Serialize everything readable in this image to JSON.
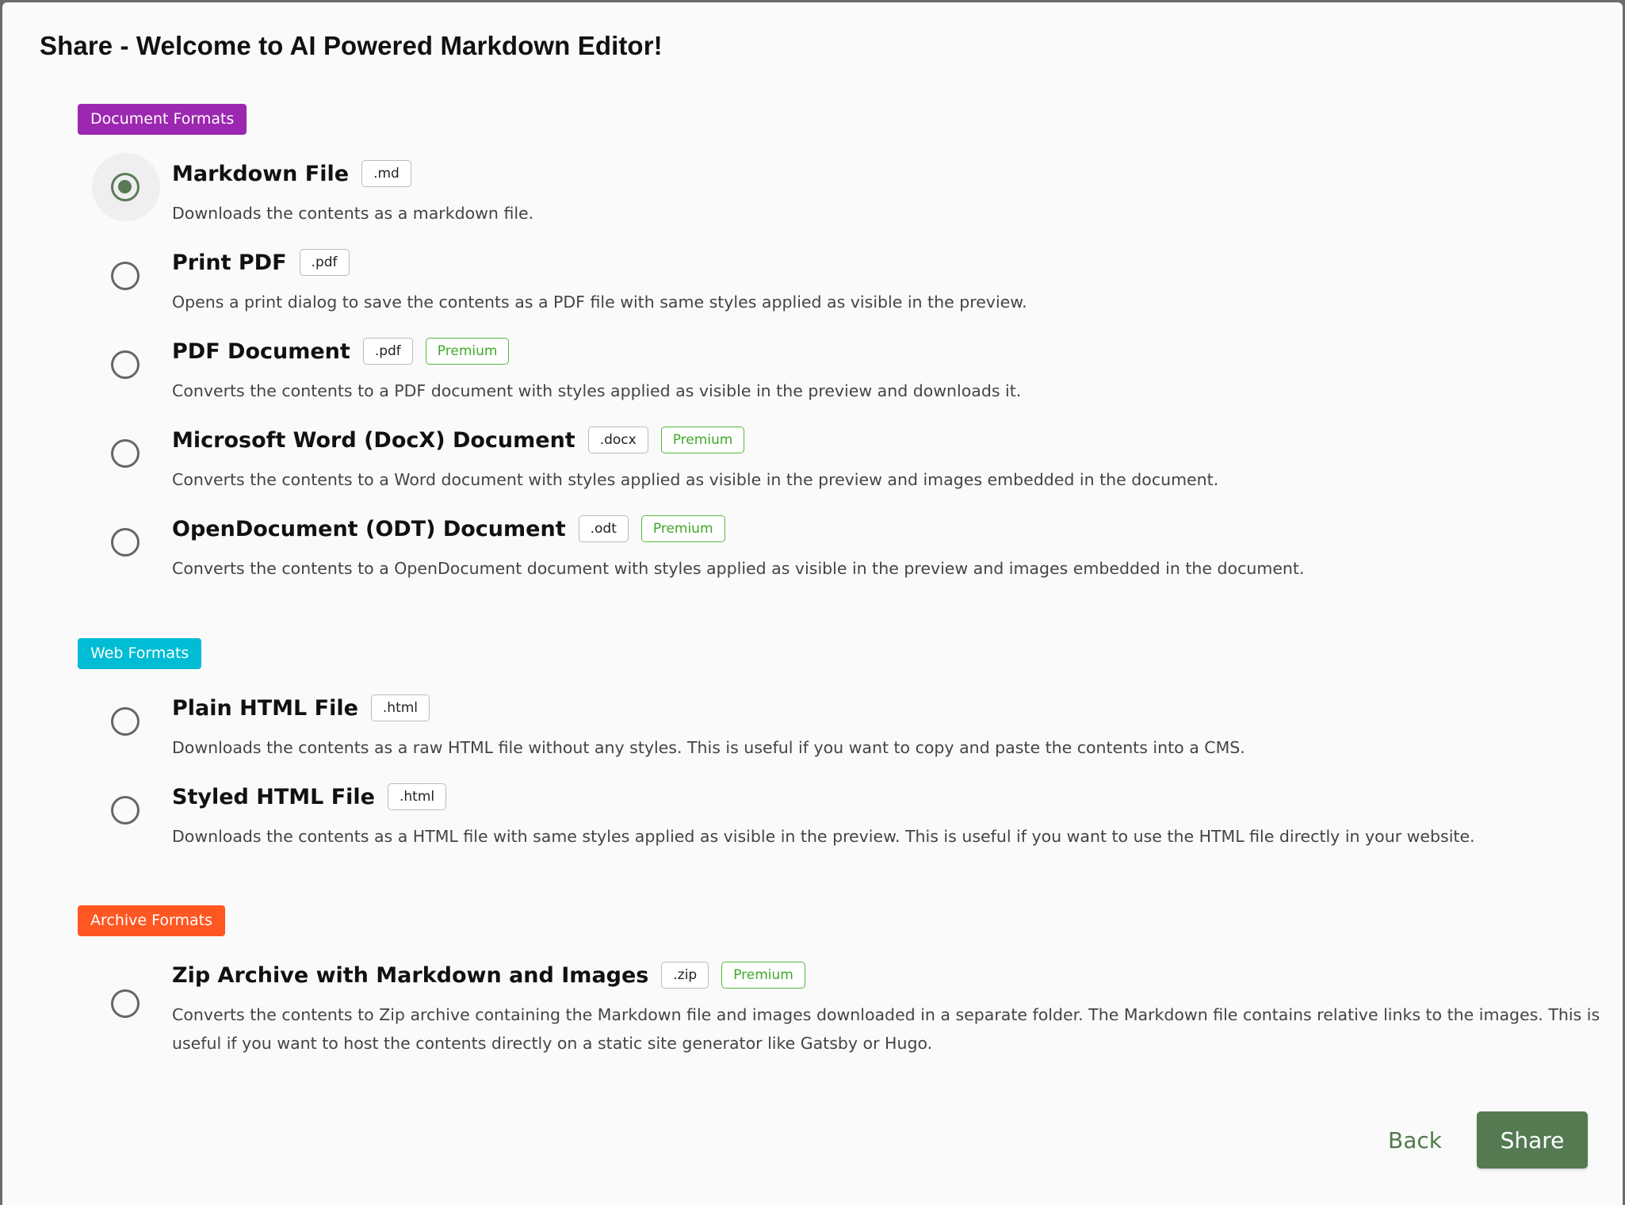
{
  "dialog": {
    "title": "Share - Welcome to AI Powered Markdown Editor!"
  },
  "sections": [
    {
      "label": "Document Formats",
      "color": "#9c27b0",
      "options": [
        {
          "title": "Markdown File",
          "ext": ".md",
          "premium": "",
          "desc": "Downloads the contents as a markdown file.",
          "selected": true
        },
        {
          "title": "Print PDF",
          "ext": ".pdf",
          "premium": "",
          "desc": "Opens a print dialog to save the contents as a PDF file with same styles applied as visible in the preview.",
          "selected": false
        },
        {
          "title": "PDF Document",
          "ext": ".pdf",
          "premium": "Premium",
          "desc": "Converts the contents to a PDF document with styles applied as visible in the preview and downloads it.",
          "selected": false
        },
        {
          "title": "Microsoft Word (DocX) Document",
          "ext": ".docx",
          "premium": "Premium",
          "desc": "Converts the contents to a Word document with styles applied as visible in the preview and images embedded in the document.",
          "selected": false
        },
        {
          "title": "OpenDocument (ODT) Document",
          "ext": ".odt",
          "premium": "Premium",
          "desc": "Converts the contents to a OpenDocument document with styles applied as visible in the preview and images embedded in the document.",
          "selected": false
        }
      ]
    },
    {
      "label": "Web Formats",
      "color": "#00bcd4",
      "options": [
        {
          "title": "Plain HTML File",
          "ext": ".html",
          "premium": "",
          "desc": "Downloads the contents as a raw HTML file without any styles. This is useful if you want to copy and paste the contents into a CMS.",
          "selected": false
        },
        {
          "title": "Styled HTML File",
          "ext": ".html",
          "premium": "",
          "desc": "Downloads the contents as a HTML file with same styles applied as visible in the preview. This is useful if you want to use the HTML file directly in your website.",
          "selected": false
        }
      ]
    },
    {
      "label": "Archive Formats",
      "color": "#ff5722",
      "options": [
        {
          "title": "Zip Archive with Markdown and Images",
          "ext": ".zip",
          "premium": "Premium",
          "desc": "Converts the contents to Zip archive containing the Markdown file and images downloaded in a separate folder. The Markdown file contains relative links to the images. This is useful if you want to host the contents directly on a static site generator like Gatsby or Hugo.",
          "selected": false
        }
      ]
    }
  ],
  "footer": {
    "back_label": "Back",
    "share_label": "Share",
    "accent_color": "#557a52"
  }
}
